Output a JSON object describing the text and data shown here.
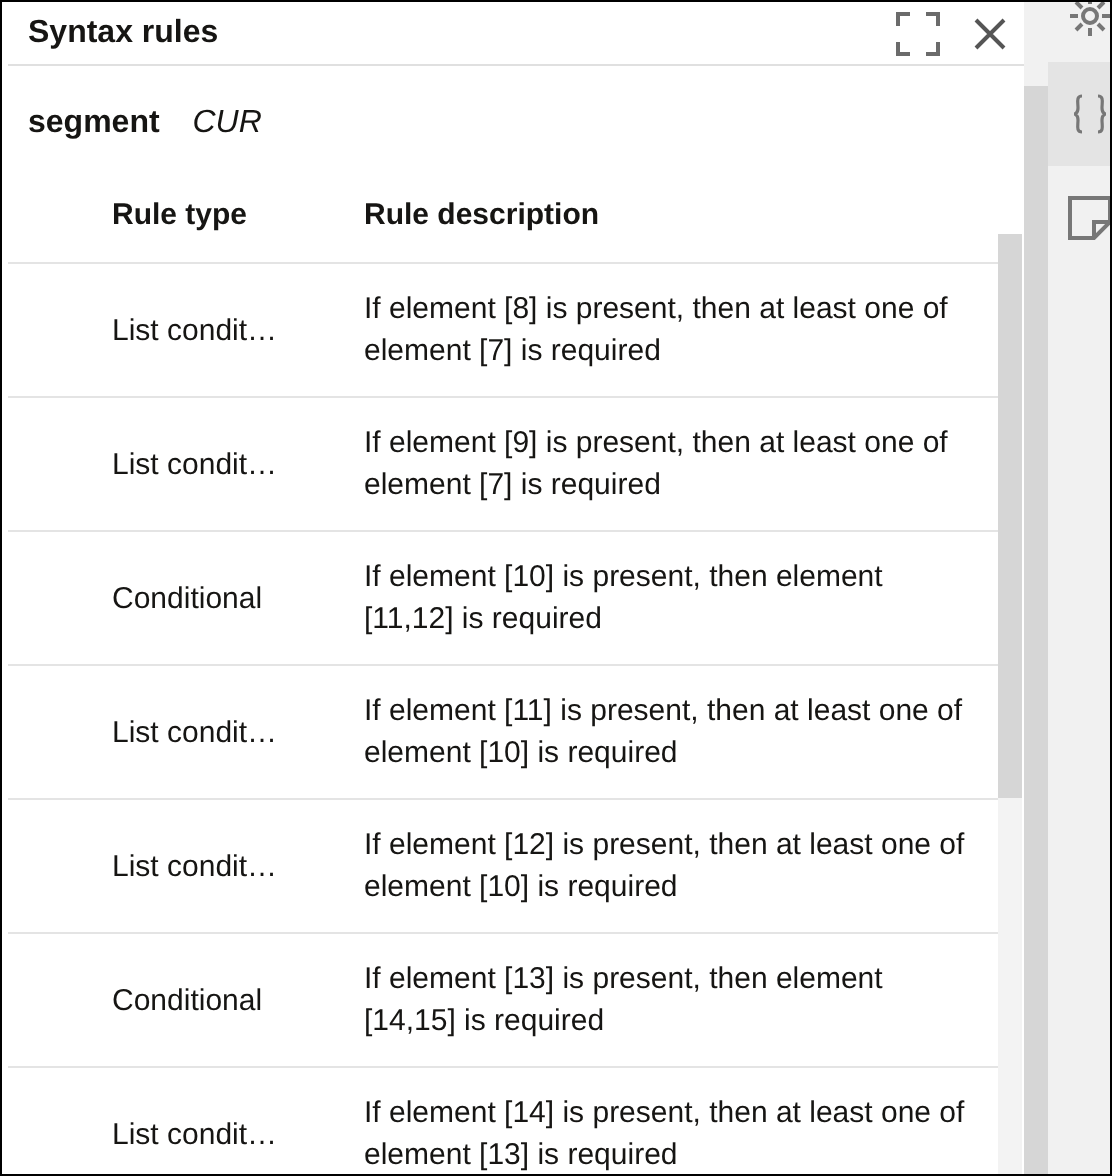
{
  "panel": {
    "title": "Syntax rules"
  },
  "segment": {
    "label": "segment",
    "value": "CUR"
  },
  "table": {
    "columns": [
      "Rule type",
      "Rule description"
    ],
    "rows": [
      {
        "type": "List condit…",
        "description": "If element [8] is present, then at least one of element [7] is required"
      },
      {
        "type": "List condit…",
        "description": "If element [9] is present, then at least one of element [7] is required"
      },
      {
        "type": "Conditional",
        "description": "If element [10] is present, then element [11,12] is required"
      },
      {
        "type": "List condit…",
        "description": "If element [11] is present, then at least one of element [10] is required"
      },
      {
        "type": "List condit…",
        "description": "If element [12] is present, then at least one of element [10] is required"
      },
      {
        "type": "Conditional",
        "description": "If element [13] is present, then element [14,15] is required"
      },
      {
        "type": "List condit…",
        "description": "If element [14] is present, then at least one of element [13] is required"
      }
    ]
  }
}
